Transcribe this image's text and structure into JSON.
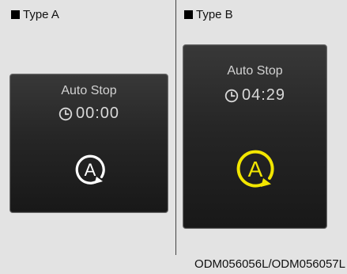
{
  "type_a": {
    "label": "Type A",
    "title": "Auto Stop",
    "time": "00:00",
    "icon_letter": "A",
    "icon_color": "#ffffff"
  },
  "type_b": {
    "label": "Type B",
    "title": "Auto Stop",
    "time": "04:29",
    "icon_letter": "A",
    "icon_color": "#f2e600"
  },
  "caption": "ODM056056L/ODM056057L"
}
